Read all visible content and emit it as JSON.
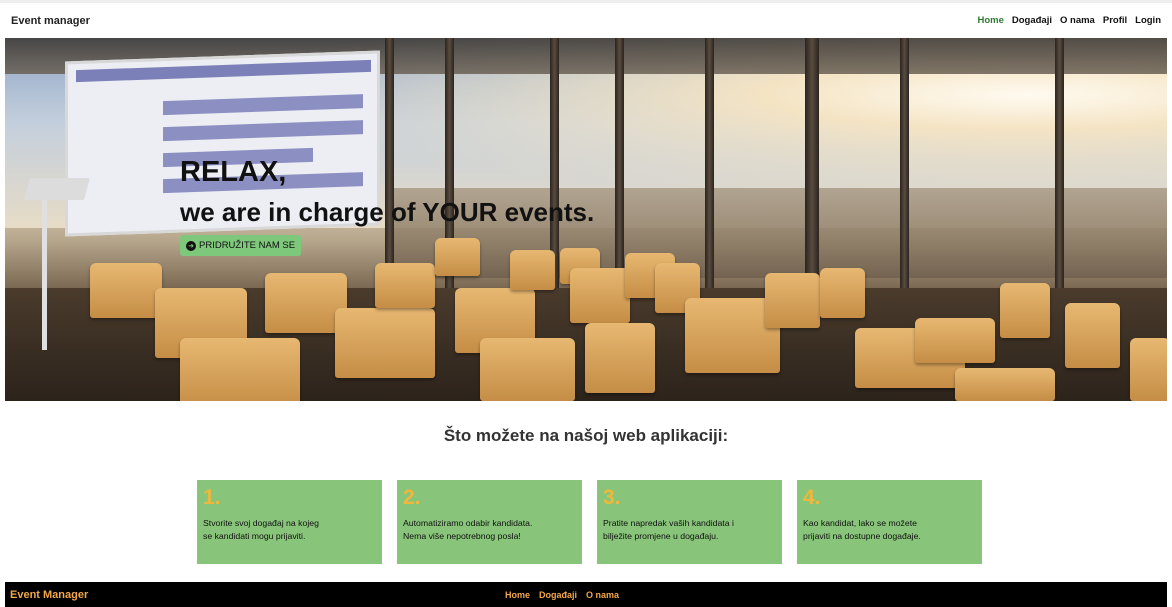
{
  "navbar": {
    "brand": "Event manager",
    "links": [
      {
        "label": "Home",
        "active": true
      },
      {
        "label": "Događaji",
        "active": false
      },
      {
        "label": "O nama",
        "active": false
      },
      {
        "label": "Profil",
        "active": false
      },
      {
        "label": "Login",
        "active": false
      }
    ]
  },
  "hero": {
    "title": "RELAX,",
    "subtitle": "we are in charge of YOUR events.",
    "button_label": "PRIDRUŽITE NAM SE",
    "button_icon": "arrow-circle-right-icon"
  },
  "features": {
    "title": "Što možete na našoj web aplikaciji:",
    "cards": [
      {
        "number": "1.",
        "text_line1": "Stvorite svoj događaj na kojeg",
        "text_line2": "se kandidati mogu prijaviti."
      },
      {
        "number": "2.",
        "text_line1": "Automatiziramo odabir kandidata.",
        "text_line2": "Nema više nepotrebnog posla!"
      },
      {
        "number": "3.",
        "text_line1": "Pratite napredak vaših kandidata i",
        "text_line2": "bilježite promjene u događaju."
      },
      {
        "number": "4.",
        "text_line1": "Kao kandidat, lako se možete",
        "text_line2": "prijaviti na dostupne događaje."
      }
    ]
  },
  "footer": {
    "brand": "Event Manager",
    "links": [
      "Home",
      "Događaji",
      "O nama"
    ]
  },
  "colors": {
    "accent_green": "#88c57a",
    "number_orange": "#f1b73c",
    "footer_link": "#f1a84a",
    "active_nav": "#2e7d32"
  }
}
